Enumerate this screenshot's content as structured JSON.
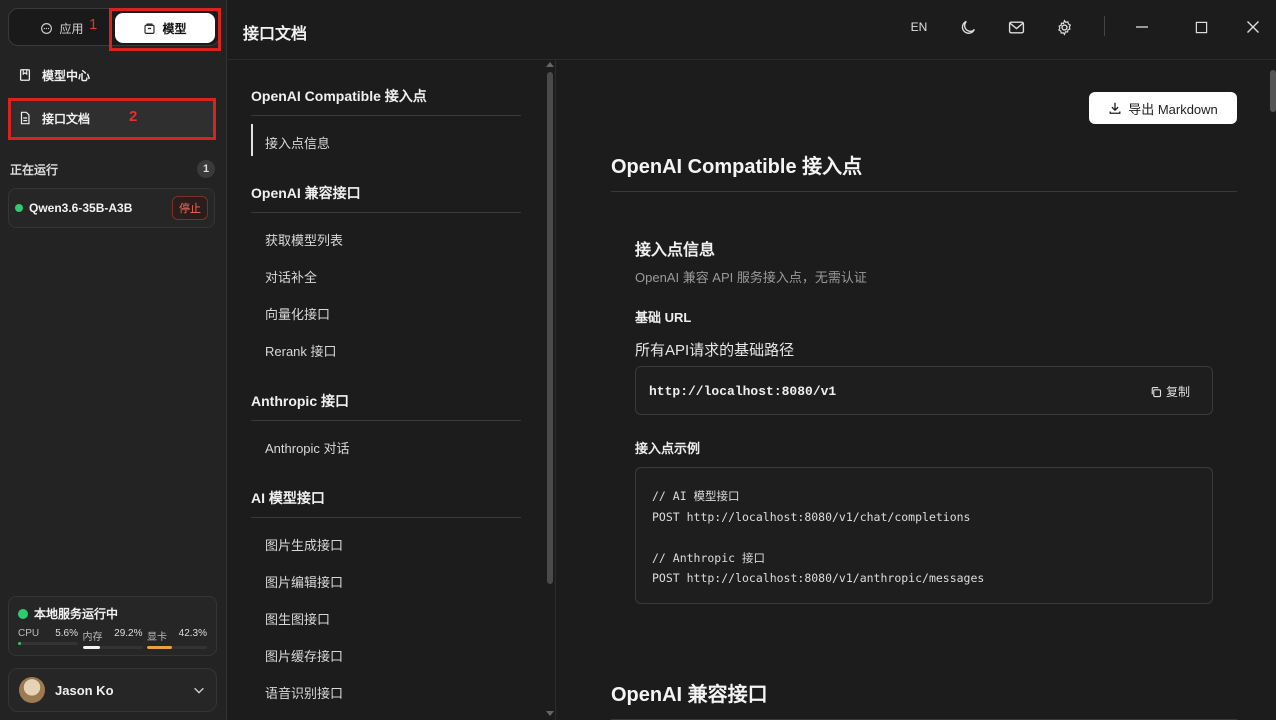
{
  "sidebar": {
    "segment": {
      "app_label": "应用",
      "model_label": "模型"
    },
    "markers": {
      "one": "1",
      "two": "2"
    },
    "nav": [
      {
        "label": "模型中心",
        "icon": "bookmark-icon"
      },
      {
        "label": "接口文档",
        "icon": "document-icon"
      }
    ],
    "running": {
      "title": "正在运行",
      "count": "1",
      "model_name": "Qwen3.6-35B-A3B",
      "stop_label": "停止"
    },
    "service": {
      "title": "本地服务运行中",
      "cpu_label": "CPU",
      "cpu_value": "5.6%",
      "cpu_fraction": 0.056,
      "mem_label": "内存",
      "mem_value": "29.2%",
      "mem_fraction": 0.292,
      "gpu_label": "显卡",
      "gpu_value": "42.3%",
      "gpu_fraction": 0.423
    },
    "user": {
      "name": "Jason Ko"
    }
  },
  "topbar": {
    "title": "接口文档",
    "lang": "EN"
  },
  "toc": {
    "groups": [
      {
        "heading": "OpenAI Compatible 接入点",
        "items": [
          "接入点信息"
        ]
      },
      {
        "heading": "OpenAI 兼容接口",
        "items": [
          "获取模型列表",
          "对话补全",
          "向量化接口",
          "Rerank 接口"
        ]
      },
      {
        "heading": "Anthropic 接口",
        "items": [
          "Anthropic 对话"
        ]
      },
      {
        "heading": "AI 模型接口",
        "items": [
          "图片生成接口",
          "图片编辑接口",
          "图生图接口",
          "图片缓存接口",
          "语音识别接口"
        ]
      }
    ]
  },
  "content": {
    "export_label": "导出 Markdown",
    "section1_title": "OpenAI Compatible 接入点",
    "endpoint_title": "接入点信息",
    "endpoint_desc": "OpenAI 兼容 API 服务接入点，无需认证",
    "base_url_label": "基础 URL",
    "base_url_desc": "所有API请求的基础路径",
    "base_url": "http://localhost:8080/v1",
    "copy_label": "复制",
    "example_label": "接入点示例",
    "code_lines": [
      "// AI 模型接口",
      "POST http://localhost:8080/v1/chat/completions",
      "",
      "// Anthropic 接口",
      "POST http://localhost:8080/v1/anthropic/messages"
    ],
    "section2_title": "OpenAI 兼容接口"
  },
  "colors": {
    "accent_green": "#2ecc71",
    "marker_red": "#d9231f",
    "stop_red": "#f06b5c",
    "gpu_bar": "#e8a33a"
  }
}
